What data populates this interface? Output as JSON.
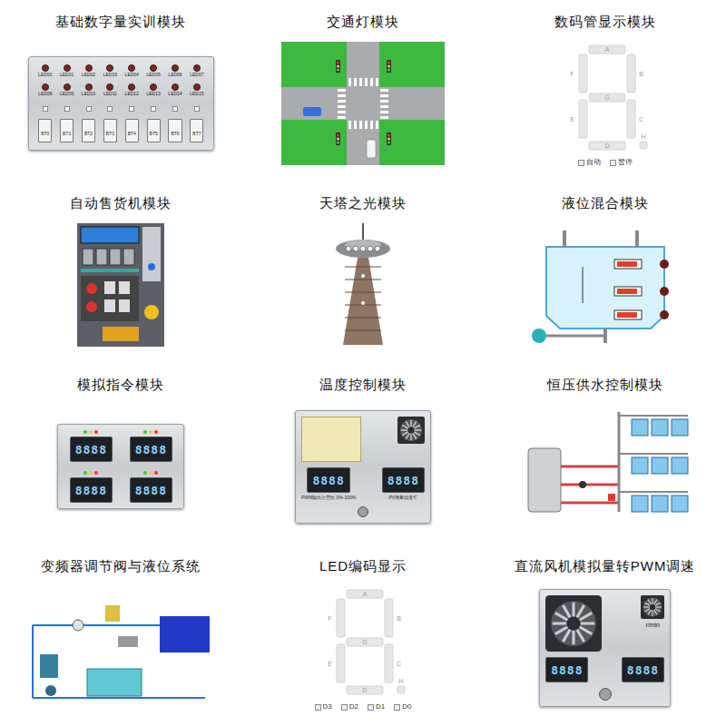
{
  "modules": [
    {
      "title": "基础数字量实训模块",
      "kind": "digital-io",
      "leds": [
        [
          "LED00",
          "LED01",
          "LED02",
          "LED03",
          "LED04",
          "LED05",
          "LED06",
          "LED07"
        ],
        [
          "LED08",
          "LED09",
          "LED10",
          "LED11",
          "LED12",
          "LED13",
          "LED14",
          "LED15"
        ]
      ],
      "buttons": [
        "BT0",
        "BT1",
        "BT2",
        "BT3",
        "BT4",
        "BT5",
        "BT6",
        "BT7"
      ]
    },
    {
      "title": "交通灯模块",
      "kind": "traffic"
    },
    {
      "title": "数码管显示模块",
      "kind": "seven-seg",
      "segments": [
        "A",
        "B",
        "C",
        "D",
        "E",
        "F",
        "G",
        "H"
      ],
      "checks": [
        {
          "label": "自动",
          "checked": false
        },
        {
          "label": "暂停",
          "checked": false
        }
      ]
    },
    {
      "title": "自动售货机模块",
      "kind": "vending"
    },
    {
      "title": "天塔之光模块",
      "kind": "tower"
    },
    {
      "title": "液位混合模块",
      "kind": "tank"
    },
    {
      "title": "模拟指令模块",
      "kind": "instrument",
      "readouts": [
        "8888",
        "8888",
        "8888",
        "8888"
      ]
    },
    {
      "title": "温度控制模块",
      "kind": "temperature",
      "readouts": [
        "8888",
        "8888"
      ],
      "captions": [
        "PWM输出占空比 0%-100%",
        "PV测量温度℃"
      ]
    },
    {
      "title": "恒压供水控制模块",
      "kind": "water"
    },
    {
      "title": "变频器调节阀与液位系统",
      "kind": "valve"
    },
    {
      "title": "LED编码显示",
      "kind": "seven-seg",
      "segments": [
        "A",
        "B",
        "C",
        "D",
        "E",
        "F",
        "G",
        "H"
      ],
      "checks": [
        {
          "label": "D3",
          "checked": false
        },
        {
          "label": "D2",
          "checked": false
        },
        {
          "label": "D1",
          "checked": false
        },
        {
          "label": "D0",
          "checked": false
        }
      ]
    },
    {
      "title": "直流风机模拟量转PWM调速",
      "kind": "fan",
      "readouts": [
        "8888",
        "8888"
      ],
      "unit": "r/min"
    }
  ]
}
